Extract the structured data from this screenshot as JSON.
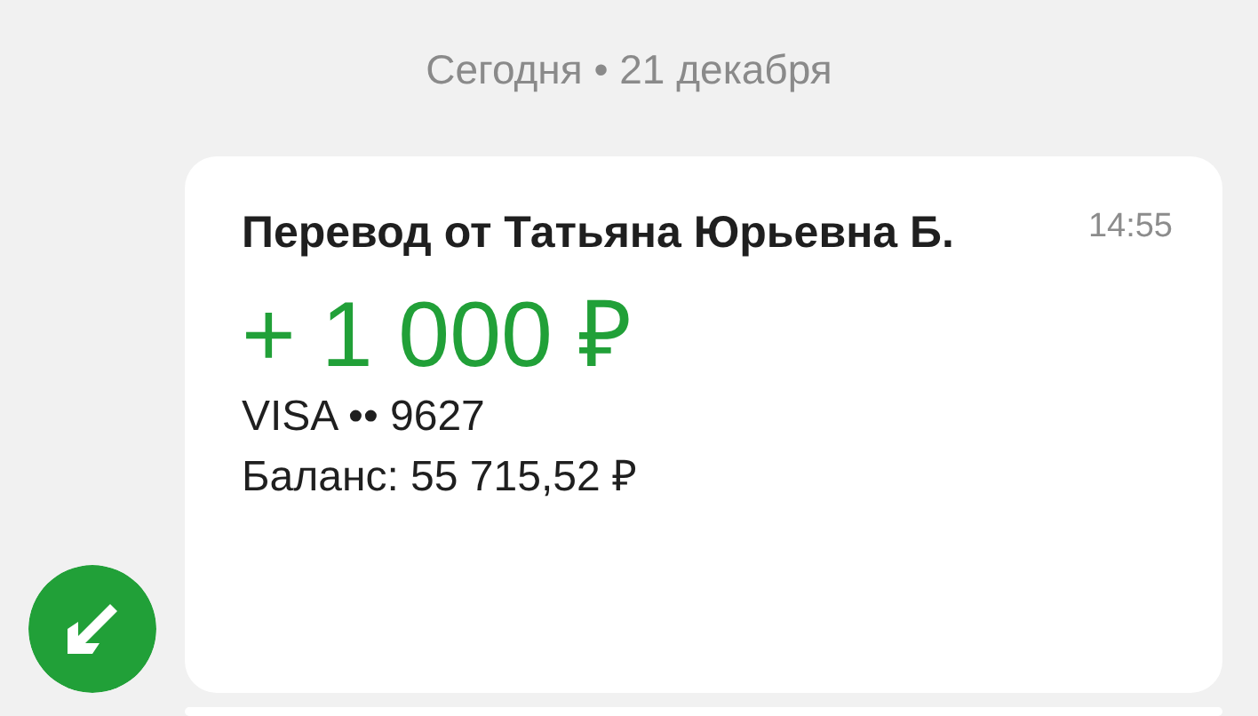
{
  "date_header": "Сегодня • 21 декабря",
  "message": {
    "incoming": true,
    "title": "Перевод от Татьяна Юрьевна Б.",
    "time": "14:55",
    "amount": "+ 1 000 ₽",
    "card": "VISA •• 9627",
    "balance": "Баланс: 55 715,52 ₽"
  }
}
